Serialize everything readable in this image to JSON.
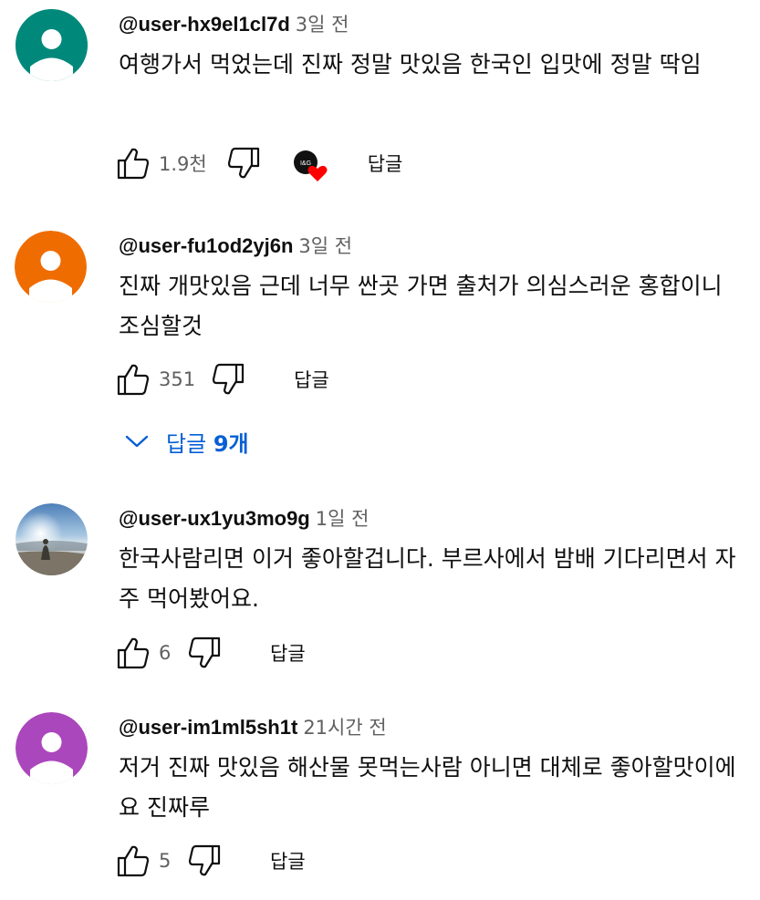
{
  "comments": [
    {
      "author": "@user-hx9el1cl7d",
      "time": "3일 전",
      "text": "여행가서 먹었는데 진짜 정말 맛있음 한국인 입맛에 정말 딱임",
      "likes": "1.9천",
      "reply_label": "답글",
      "creator_heart_badge": "I&G",
      "avatar_color": "#00897b"
    },
    {
      "author": "@user-fu1od2yj6n",
      "time": "3일 전",
      "text": "진짜 개맛있음 근데 너무 싼곳 가면 출처가 의심스러운 홍합이니 조심할것",
      "likes": "351",
      "reply_label": "답글",
      "avatar_color": "#ef6c00"
    },
    {
      "author": "@user-ux1yu3mo9g",
      "time": "1일 전",
      "text": "한국사람리면 이거 좋아할겁니다. 부르사에서 밤배 기다리면서 자주 먹어봤어요.",
      "likes": "6",
      "reply_label": "답글",
      "avatar_color": "photo"
    },
    {
      "author": "@user-im1ml5sh1t",
      "time": "21시간 전",
      "text": "저거 진짜 맛있음 해산물 못먹는사람 아니면 대체로 좋아할맛이에요 진짜루",
      "likes": "5",
      "reply_label": "답글",
      "avatar_color": "#ab47bc"
    }
  ],
  "replies_toggle": {
    "label": "답글",
    "count": "9개"
  },
  "colors": {
    "link_blue": "#065fd4",
    "secondary_text": "#606060",
    "heart_red": "#ff0000"
  }
}
